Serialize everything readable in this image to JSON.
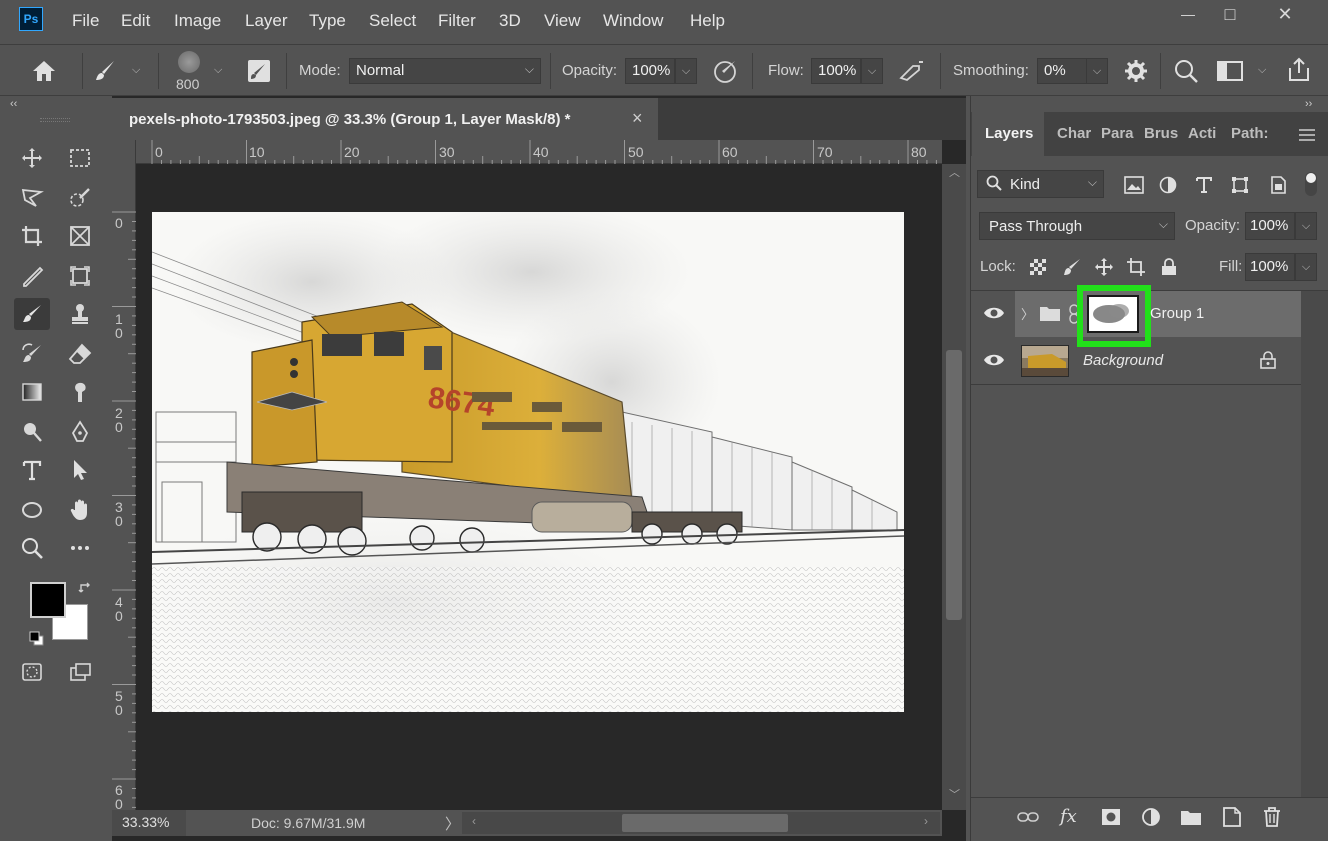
{
  "app": {
    "logo": "Ps"
  },
  "menu": [
    "File",
    "Edit",
    "Image",
    "Layer",
    "Type",
    "Select",
    "Filter",
    "3D",
    "View",
    "Window",
    "Help"
  ],
  "window_controls": {
    "minimize": "—",
    "restore": "□",
    "close": "✕"
  },
  "options": {
    "brush_size": "800",
    "mode_label": "Mode:",
    "mode_value": "Normal",
    "opacity_label": "Opacity:",
    "opacity_value": "100%",
    "flow_label": "Flow:",
    "flow_value": "100%",
    "smoothing_label": "Smoothing:",
    "smoothing_value": "0%"
  },
  "collapse_left": "‹‹",
  "collapse_right": "››",
  "document": {
    "tab_title": "pexels-photo-1793503.jpeg @ 33.3% (Group 1, Layer Mask/8) *",
    "close": "×",
    "ruler_h": [
      "0",
      "10",
      "20",
      "30",
      "40",
      "50",
      "60",
      "70",
      "80"
    ],
    "ruler_v": [
      "0",
      "1\n0",
      "2\n0",
      "3\n0",
      "4\n0",
      "5\n0",
      "6\n0"
    ],
    "image_number": "8674"
  },
  "status": {
    "zoom": "33.33%",
    "doc": "Doc: 9.67M/31.9M",
    "arrow": "〉"
  },
  "panel": {
    "tabs": [
      "Layers",
      "Char",
      "Para",
      "Brus",
      "Acti",
      "Path:"
    ],
    "filter_kind": "Kind",
    "blend_mode": "Pass Through",
    "opacity_label": "Opacity:",
    "opacity_value": "100%",
    "lock_label": "Lock:",
    "fill_label": "Fill:",
    "fill_value": "100%",
    "layers": [
      {
        "name": "Group 1",
        "type": "group",
        "selected": true
      },
      {
        "name": "Background",
        "type": "background",
        "locked": true
      }
    ],
    "footer_fx": "fx"
  },
  "colors": {
    "accent_highlight": "#22e01a",
    "foreground": "#000000",
    "background": "#ffffff",
    "locomotive": "#d8a72a"
  }
}
